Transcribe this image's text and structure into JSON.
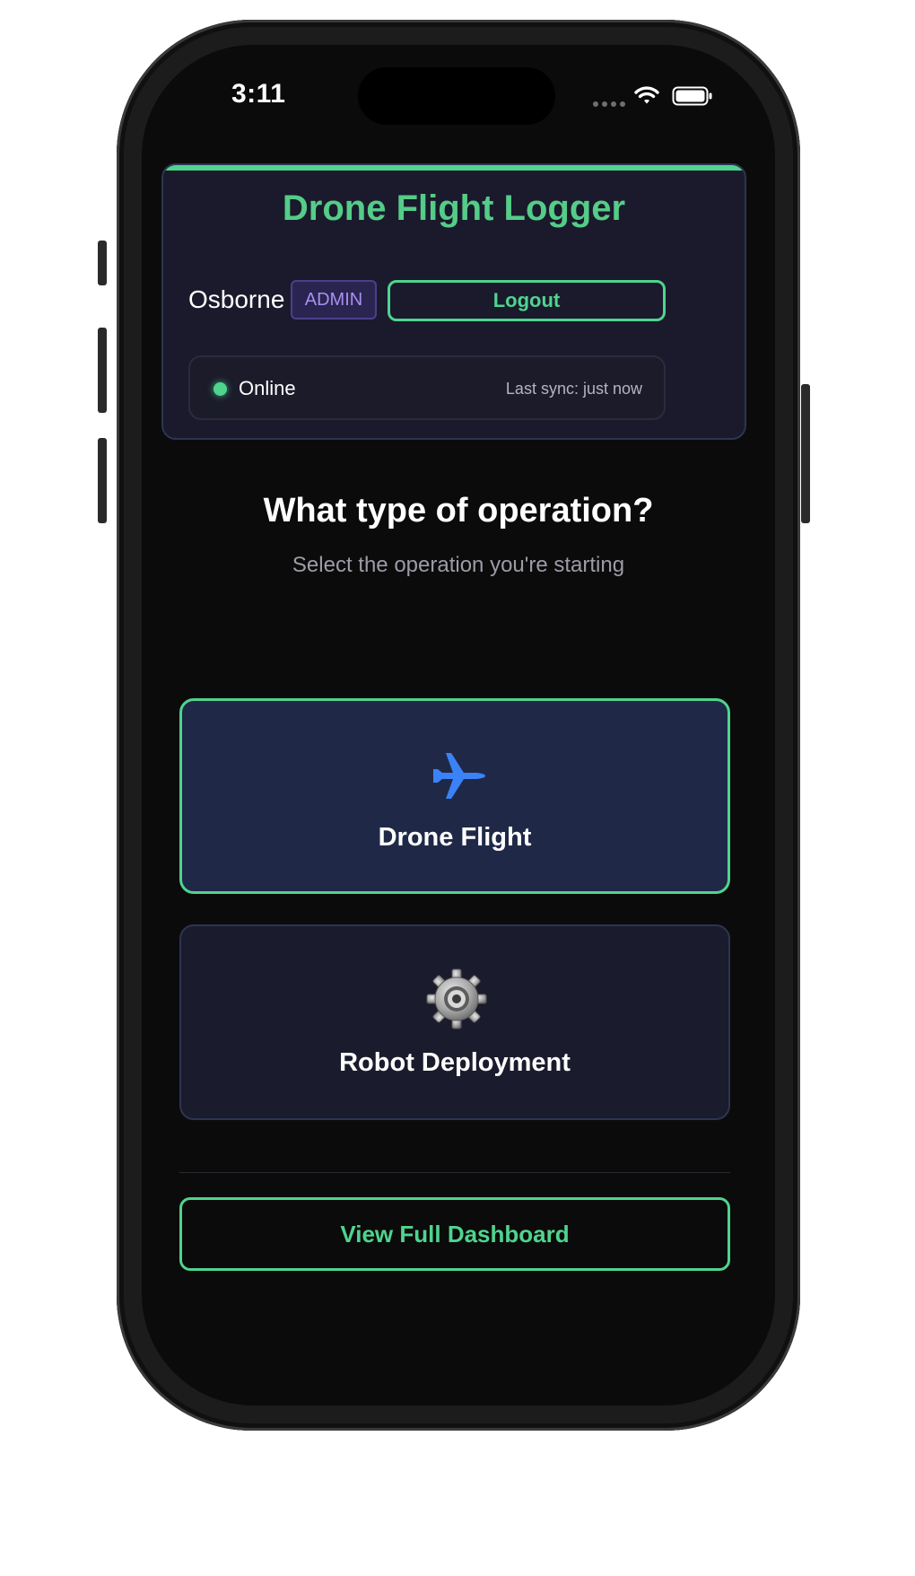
{
  "status_bar": {
    "time": "3:11"
  },
  "header": {
    "title": "Drone Flight Logger",
    "user_name": "Osborne",
    "role_badge": "ADMIN",
    "logout_label": "Logout",
    "connection_status": "Online",
    "last_sync": "Last sync: just now"
  },
  "main": {
    "question": "What type of operation?",
    "subtitle": "Select the operation you're starting",
    "options": [
      {
        "label": "Drone Flight",
        "icon": "airplane-icon",
        "selected": true
      },
      {
        "label": "Robot Deployment",
        "icon": "gear-icon",
        "selected": false
      }
    ],
    "dashboard_label": "View Full Dashboard"
  },
  "colors": {
    "accent": "#4fd48e",
    "title": "#55cc88",
    "badge_text": "#a98ff0",
    "airplane_icon": "#3b82f6",
    "background": "#0b0b0c",
    "card": "#1a1a2c",
    "selected_card": "#1f2947"
  }
}
